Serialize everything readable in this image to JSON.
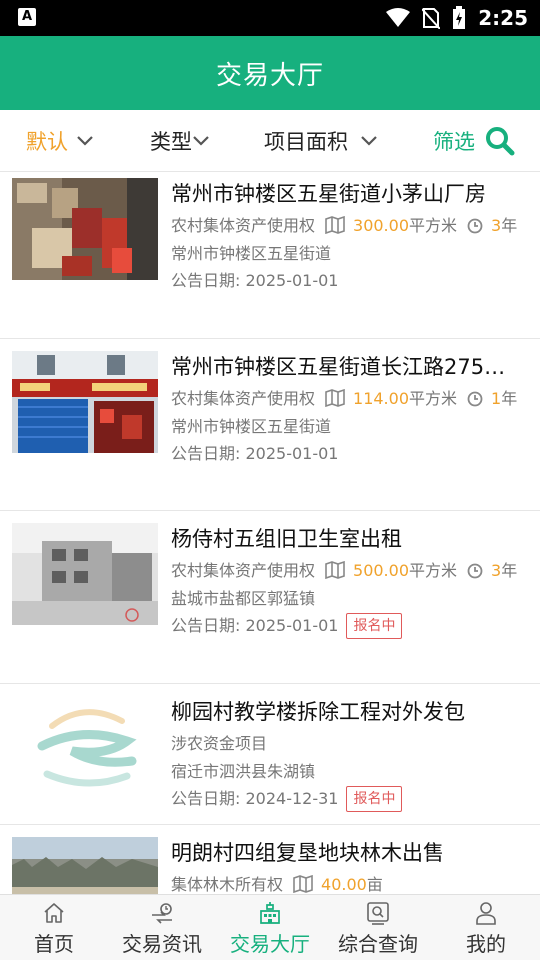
{
  "status_bar": {
    "time": "2:25",
    "left_badge": "A"
  },
  "header": {
    "title": "交易大厅"
  },
  "filters": [
    {
      "label": "默认",
      "state": "active"
    },
    {
      "label": "类型"
    },
    {
      "label": "项目面积"
    },
    {
      "label": "筛选",
      "icon": "search-icon"
    }
  ],
  "listings": [
    {
      "title": "常州市钟楼区五星街道小茅山厂房",
      "category": "农村集体资产使用权",
      "area": "300.00",
      "area_unit": "平方米",
      "term": "3",
      "term_unit": "年",
      "location": "常州市钟楼区五星街道",
      "date_label": "公告日期:",
      "date": "2025-01-01",
      "badge": "",
      "image": "warehouse-photo"
    },
    {
      "title": "常州市钟楼区五星街道长江路275…",
      "category": "农村集体资产使用权",
      "area": "114.00",
      "area_unit": "平方米",
      "term": "1",
      "term_unit": "年",
      "location": "常州市钟楼区五星街道",
      "date_label": "公告日期:",
      "date": "2025-01-01",
      "badge": "",
      "image": "storefront-photo"
    },
    {
      "title": "杨侍村五组旧卫生室出租",
      "category": "农村集体资产使用权",
      "area": "500.00",
      "area_unit": "平方米",
      "term": "3",
      "term_unit": "年",
      "location": "盐城市盐都区郭猛镇",
      "date_label": "公告日期:",
      "date": "2025-01-01",
      "badge": "报名中",
      "image": "building-bw-photo"
    },
    {
      "title": "柳园村教学楼拆除工程对外发包",
      "category": "涉农资金项目",
      "location": "宿迁市泗洪县朱湖镇",
      "date_label": "公告日期:",
      "date": "2024-12-31",
      "badge": "报名中",
      "image": "logo-placeholder"
    },
    {
      "title": "明朗村四组复垦地块林木出售",
      "category": "集体林木所有权",
      "area": "40.00",
      "area_unit": "亩",
      "image": "trees-photo"
    }
  ],
  "bottom_nav": [
    {
      "label": "首页",
      "icon": "home-icon"
    },
    {
      "label": "交易资讯",
      "icon": "news-icon"
    },
    {
      "label": "交易大厅",
      "icon": "hall-icon",
      "active": true
    },
    {
      "label": "综合查询",
      "icon": "query-icon"
    },
    {
      "label": "我的",
      "icon": "user-icon"
    }
  ],
  "colors": {
    "primary": "#17b07e",
    "accent": "#f0a22c",
    "badge": "#e05a5a"
  }
}
